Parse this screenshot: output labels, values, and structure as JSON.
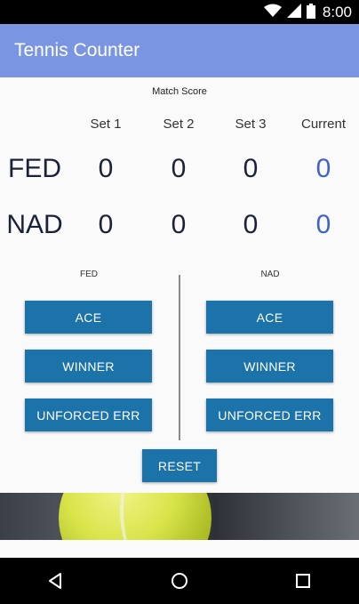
{
  "status_bar": {
    "time": "8:00"
  },
  "app_bar": {
    "title": "Tennis Counter"
  },
  "score_table": {
    "caption": "Match Score",
    "headers": [
      "Set 1",
      "Set 2",
      "Set 3",
      "Current"
    ],
    "players": [
      {
        "name": "FED",
        "sets": [
          "0",
          "0",
          "0"
        ],
        "current": "0"
      },
      {
        "name": "NAD",
        "sets": [
          "0",
          "0",
          "0"
        ],
        "current": "0"
      }
    ]
  },
  "controls": {
    "fed": {
      "label": "FED",
      "ace": "ACE",
      "winner": "WINNER",
      "unforced": "UNFORCED ERR"
    },
    "nad": {
      "label": "NAD",
      "ace": "ACE",
      "winner": "WINNER",
      "unforced": "UNFORCED ERR"
    },
    "reset": "RESET"
  },
  "colors": {
    "app_bar": "#7a95e2",
    "button": "#1c73a9",
    "current_score": "#3f63c9"
  },
  "icons": [
    "wifi-icon",
    "signal-icon",
    "battery-icon",
    "back-icon",
    "home-icon",
    "recents-icon"
  ]
}
